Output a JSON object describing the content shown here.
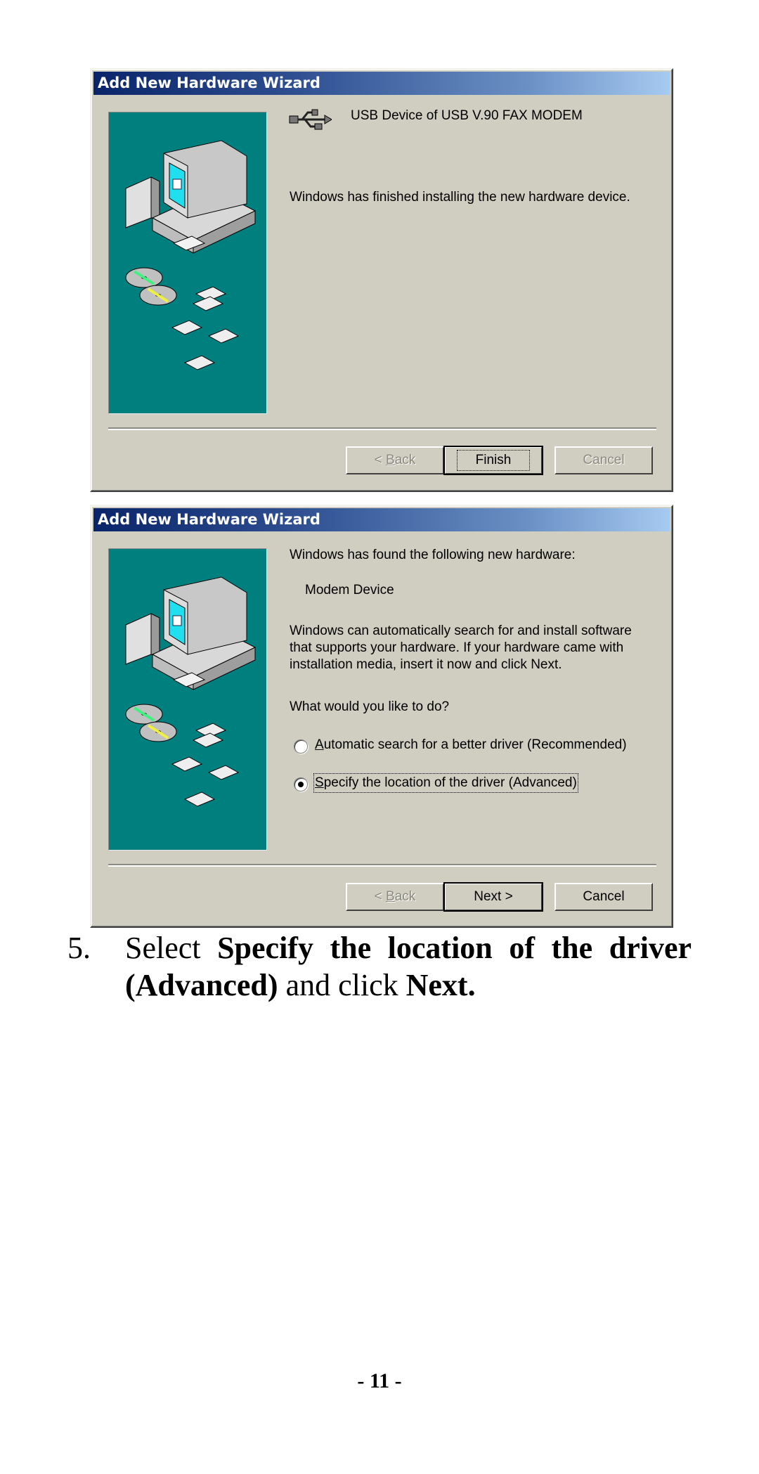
{
  "wizard1": {
    "title": "Add New Hardware Wizard",
    "device_icon": "usb-icon",
    "device_name": "USB Device of USB V.90 FAX MODEM",
    "message": "Windows has finished installing the new hardware device.",
    "buttons": {
      "back": {
        "prefix": "< ",
        "mnemonic": "B",
        "rest": "ack",
        "enabled": false
      },
      "finish": {
        "label": "Finish",
        "enabled": true,
        "default": true
      },
      "cancel": {
        "label": "Cancel",
        "enabled": false
      }
    }
  },
  "wizard2": {
    "title": "Add New Hardware Wizard",
    "found_label": "Windows has found the following new hardware:",
    "device_name": "Modem Device",
    "description_lines": [
      "Windows can automatically search for and install software",
      "that supports your hardware. If your hardware came with",
      "installation media, insert it now and click Next."
    ],
    "question": "What would you like to do?",
    "options": [
      {
        "mnemonic": "A",
        "rest": "utomatic search for a better driver (Recommended)",
        "checked": false
      },
      {
        "mnemonic": "S",
        "rest": "pecify the location of the driver (Advanced)",
        "checked": true
      }
    ],
    "buttons": {
      "back": {
        "prefix": "< ",
        "mnemonic": "B",
        "rest": "ack",
        "enabled": false
      },
      "next": {
        "label": "Next >",
        "enabled": true,
        "default": true
      },
      "cancel": {
        "label": "Cancel",
        "enabled": true
      }
    }
  },
  "instruction": {
    "number": "5.",
    "text_1": "Select ",
    "bold_1": "Specify the location of the driver",
    "bold_2": "(Advanced)",
    "text_2": " and click ",
    "bold_3": "Next."
  },
  "page_number": "- 11 -",
  "colors": {
    "dialog_bg": "#d0cec0",
    "title_start": "#0a246a",
    "title_end": "#a6caf0",
    "art_bg": "#007f7f"
  }
}
